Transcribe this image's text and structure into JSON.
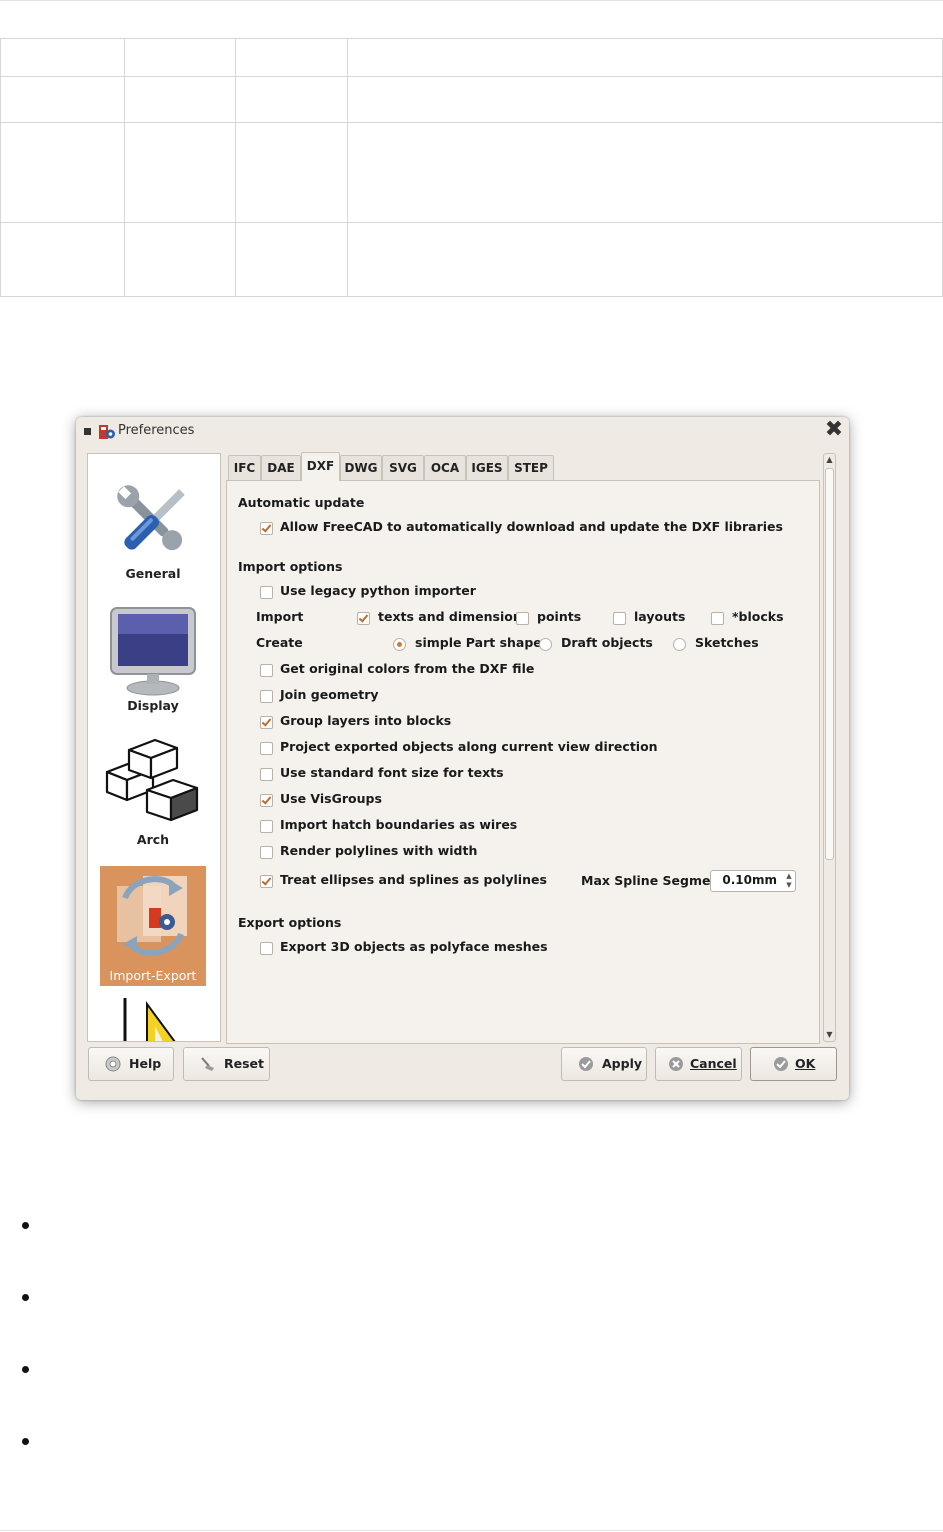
{
  "dialog": {
    "title": "Preferences",
    "close_glyph": "✖",
    "categories": [
      {
        "label": "General",
        "icon": "tools-icon"
      },
      {
        "label": "Display",
        "icon": "monitor-icon"
      },
      {
        "label": "Arch",
        "icon": "blocks-icon"
      },
      {
        "label": "Import-Export",
        "icon": "import-export-icon",
        "selected": true
      },
      {
        "label": "",
        "icon": "draft-icon"
      }
    ],
    "tabs": [
      "IFC",
      "DAE",
      "DXF",
      "DWG",
      "SVG",
      "OCA",
      "IGES",
      "STEP"
    ],
    "active_tab": "DXF",
    "sections": {
      "automatic_update": "Automatic update",
      "import_options": "Import options",
      "export_options": "Export options"
    },
    "options": {
      "allow_download": {
        "label": "Allow FreeCAD to automatically download and update the DXF libraries",
        "checked": true
      },
      "legacy_importer": {
        "label": "Use legacy python importer",
        "checked": false
      },
      "import_label": "Import",
      "import_texts": {
        "label": "texts and dimensions",
        "checked": true
      },
      "import_points": {
        "label": "points",
        "checked": false
      },
      "import_layouts": {
        "label": "layouts",
        "checked": false
      },
      "import_blocks": {
        "label": "*blocks",
        "checked": false
      },
      "create_label": "Create",
      "create_simple": {
        "label": "simple Part shapes",
        "selected": true
      },
      "create_draft": {
        "label": "Draft objects",
        "selected": false
      },
      "create_sketches": {
        "label": "Sketches",
        "selected": false
      },
      "original_colors": {
        "label": "Get original colors from the DXF file",
        "checked": false
      },
      "join_geometry": {
        "label": "Join geometry",
        "checked": false
      },
      "group_layers": {
        "label": "Group layers into blocks",
        "checked": true
      },
      "project_exported": {
        "label": "Project exported objects along current view direction",
        "checked": false
      },
      "standard_font": {
        "label": "Use standard font size for texts",
        "checked": false
      },
      "visgroups": {
        "label": "Use VisGroups",
        "checked": true
      },
      "hatch_wires": {
        "label": "Import hatch boundaries as wires",
        "checked": false
      },
      "polyline_width": {
        "label": "Render polylines with width",
        "checked": false
      },
      "ellipses_polylines": {
        "label": "Treat ellipses and splines as polylines",
        "checked": true
      },
      "max_spline_label": "Max Spline Segment:",
      "max_spline_value": "0.10mm",
      "export_polyface": {
        "label": "Export 3D objects as polyface meshes",
        "checked": false
      }
    },
    "buttons": {
      "help": "Help",
      "reset": "Reset",
      "apply": "Apply",
      "cancel": "Cancel",
      "ok": "OK"
    },
    "colors": {
      "selected_category": "#d9935d",
      "check_accent": "#c46a2c",
      "dialog_bg": "#efeae3"
    }
  }
}
